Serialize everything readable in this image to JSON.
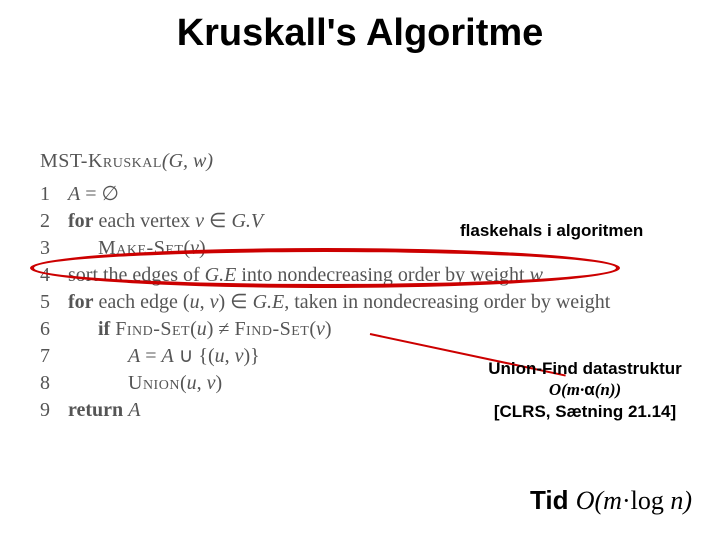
{
  "title": "Kruskall's Algoritme",
  "algo": {
    "header": "MST-Kruskal(G, w)",
    "lines": [
      {
        "n": "1",
        "code": "A = ∅"
      },
      {
        "n": "2",
        "code": "for each vertex v ∈ G.V"
      },
      {
        "n": "3",
        "code": "      Make-Set(v)"
      },
      {
        "n": "4",
        "code": "sort the edges of G.E into nondecreasing order by weight w"
      },
      {
        "n": "5",
        "code": "for each edge (u, v) ∈ G.E, taken in nondecreasing order by weight"
      },
      {
        "n": "6",
        "code": "      if Find-Set(u) ≠ Find-Set(v)"
      },
      {
        "n": "7",
        "code": "            A = A ∪ {(u, v)}"
      },
      {
        "n": "8",
        "code": "            Union(u, v)"
      },
      {
        "n": "9",
        "code": "return A"
      }
    ]
  },
  "annotations": {
    "bottleneck": "flaskehals i algoritmen",
    "unionfind_l1": "Union-Find datastruktur",
    "unionfind_l2_pre": "O(m·",
    "unionfind_l2_alpha": "α",
    "unionfind_l2_post": "(n))",
    "unionfind_l3": "[CLRS, Sætning 21.14]"
  },
  "footer": {
    "label": "Tid ",
    "big_o": "O",
    "expr_open": "(",
    "m": "m",
    "dot_log": "·log ",
    "n": "n",
    "expr_close": ")"
  }
}
